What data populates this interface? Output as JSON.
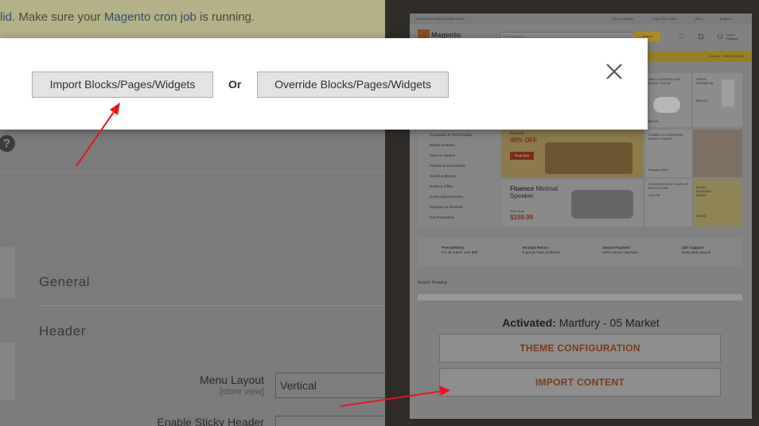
{
  "notice": {
    "prefix": "lid",
    "middle": ". Make sure your ",
    "link": "Magento cron job",
    "suffix": " is running."
  },
  "admin": {
    "sections": {
      "general": "General",
      "header": "Header"
    },
    "fields": {
      "menu_layout_label": "Menu Layout",
      "menu_layout_scope": "[store view]",
      "menu_layout_value": "Vertical",
      "sticky_header_label": "Enable Sticky Header"
    }
  },
  "preview": {
    "topbar": {
      "welcome": "Welcome to Martfury Online Store !",
      "store_location": "Store Location",
      "track_order": "Track Your Order",
      "currency": "USD ⌄",
      "language": "English ⌄"
    },
    "logo_text": "Magento",
    "search_placeholder": "I'm looking for...",
    "search_button": "Search",
    "login": "Log in",
    "register": "Register",
    "hotline": "Hotline: 1-800-234-5678",
    "categories": [
      "Computers & Technologies",
      "Babies & Moms",
      "Sport & Outdoor",
      "Phones & Accessories",
      "Health & Beauty",
      "Books & Office",
      "Home Improvements",
      "Vouchers & Services",
      "Hot Promotions"
    ],
    "banner1": {
      "tag": "Discount",
      "headline": "40% OFF",
      "cta": "Shop Now"
    },
    "banner2": {
      "title": "Fluence",
      "title_rest": "Minimal",
      "subtitle": "Speaker",
      "price_label": "Price Just",
      "price": "$159.99"
    },
    "promo_tiles": {
      "xbox": "XBOX CONTROLLER WHITE COLOR",
      "xbox_price": "$59.99",
      "apple": "APPLE IPHONE 6S",
      "apple_price": "$999.00",
      "combo": "COMBO 5X GIORDANO PACKS T-SHIRT",
      "combo_discount": "Discount 30%",
      "voucher": "VOUCHER BODY CARE AT BRATUS SPA",
      "voucher_discount": "20% Off",
      "blender": "MAGIC BLENDER MIXED",
      "blender_price": "$49.00"
    },
    "features": [
      {
        "title": "Free Delivery",
        "sub": "For all orders over $99"
      },
      {
        "title": "90 Days Return",
        "sub": "If goods have problems"
      },
      {
        "title": "Secure Payment",
        "sub": "100% secure payment"
      },
      {
        "title": "24/7 Support",
        "sub": "Dedicated support"
      }
    ],
    "trending": "Search Trending",
    "activated_label": "Activated:",
    "activated_value": " Martfury - 05 Market",
    "theme_config_button": "THEME CONFIGURATION",
    "import_content_button": "IMPORT CONTENT"
  },
  "modal": {
    "import_button": "Import Blocks/Pages/Widgets",
    "or_label": "Or",
    "override_button": "Override Blocks/Pages/Widgets"
  },
  "colors": {
    "annotation_arrow": "#e8141c",
    "accent_orange": "#c0501f"
  }
}
